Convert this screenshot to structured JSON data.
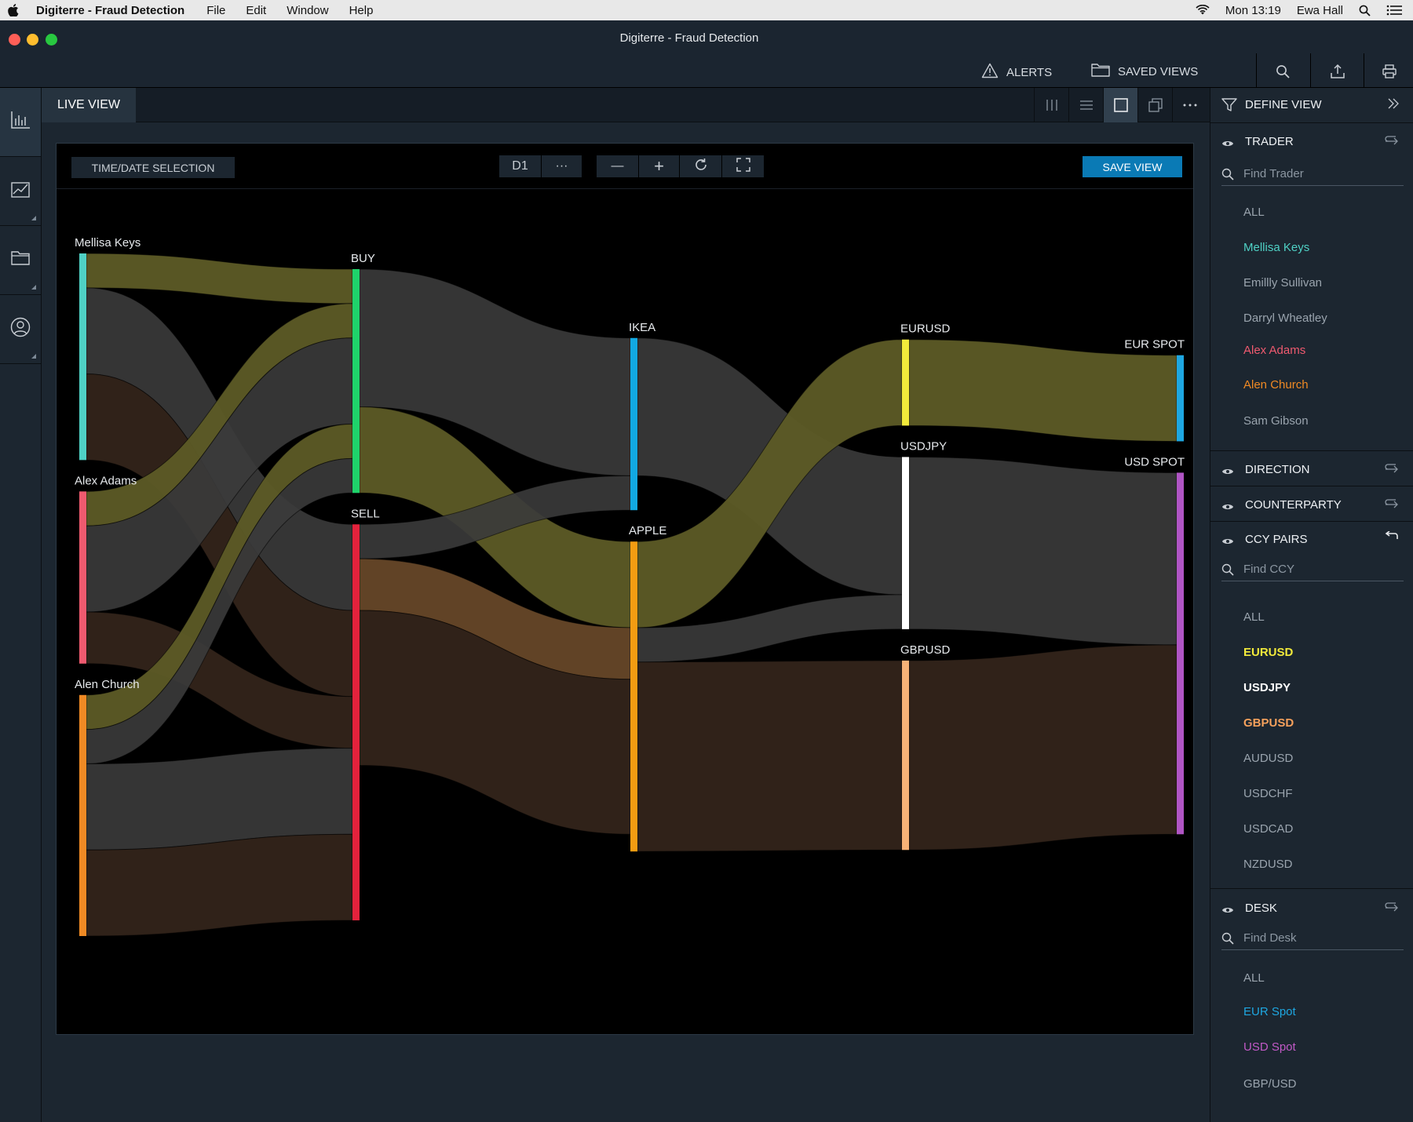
{
  "menubar": {
    "app_name": "Digiterre - Fraud Detection",
    "menus": [
      "File",
      "Edit",
      "Window",
      "Help"
    ],
    "clock": "Mon 13:19",
    "user": "Ewa Hall"
  },
  "window": {
    "title": "Digiterre - Fraud Detection",
    "alerts_label": "ALERTS",
    "saved_views_label": "SAVED VIEWS"
  },
  "tabbar": {
    "active_tab": "LIVE VIEW"
  },
  "toolbar": {
    "time_selection": "TIME/DATE SELECTION",
    "interval": "D1",
    "more": "···",
    "zoom_out": "—",
    "zoom_in": "+",
    "save_view": "SAVE VIEW"
  },
  "define_view": {
    "title": "DEFINE VIEW",
    "trader": {
      "label": "TRADER",
      "placeholder": "Find Trader",
      "items": [
        {
          "label": "ALL",
          "color": "#9aa4ae"
        },
        {
          "label": "Mellisa Keys",
          "color": "#4fd1c5"
        },
        {
          "label": "Emillly Sullivan",
          "color": "#9aa4ae"
        },
        {
          "label": "Darryl Wheatley",
          "color": "#9aa4ae"
        },
        {
          "label": "Alex Adams",
          "color": "#ef5a6f"
        },
        {
          "label": "Alen Church",
          "color": "#f08a24"
        },
        {
          "label": "Sam Gibson",
          "color": "#9aa4ae"
        }
      ]
    },
    "direction": {
      "label": "DIRECTION"
    },
    "counterparty": {
      "label": "COUNTERPARTY"
    },
    "ccy_pairs": {
      "label": "CCY PAIRS",
      "placeholder": "Find CCY",
      "items": [
        {
          "label": "ALL",
          "color": "#9aa4ae"
        },
        {
          "label": "EURUSD",
          "color": "#f2ea3b"
        },
        {
          "label": "USDJPY",
          "color": "#ffffff"
        },
        {
          "label": "GBPUSD",
          "color": "#f6a15c"
        },
        {
          "label": "AUDUSD",
          "color": "#9aa4ae"
        },
        {
          "label": "USDCHF",
          "color": "#9aa4ae"
        },
        {
          "label": "USDCAD",
          "color": "#9aa4ae"
        },
        {
          "label": "NZDUSD",
          "color": "#9aa4ae"
        }
      ]
    },
    "desk": {
      "label": "DESK",
      "placeholder": "Find Desk",
      "items": [
        {
          "label": "ALL",
          "color": "#9aa4ae"
        },
        {
          "label": "EUR Spot",
          "color": "#1ea7e1"
        },
        {
          "label": "USD Spot",
          "color": "#c25ac7"
        },
        {
          "label": "GBP/USD",
          "color": "#9aa4ae"
        }
      ]
    }
  },
  "chart_data": {
    "type": "sankey",
    "columns": [
      {
        "name": "Trader",
        "nodes": [
          "Mellisa Keys",
          "Alex Adams",
          "Alen Church"
        ]
      },
      {
        "name": "Direction",
        "nodes": [
          "BUY",
          "SELL"
        ]
      },
      {
        "name": "Counterparty",
        "nodes": [
          "IKEA",
          "APPLE"
        ]
      },
      {
        "name": "CCY Pair",
        "nodes": [
          "EURUSD",
          "USDJPY",
          "GBPUSD"
        ]
      },
      {
        "name": "Desk",
        "nodes": [
          "EUR SPOT",
          "USD SPOT"
        ]
      }
    ],
    "node_colors": {
      "Mellisa Keys": "#4fd1c5",
      "Alex Adams": "#ef5a6f",
      "Alen Church": "#f08a24",
      "BUY": "#1fd36b",
      "SELL": "#e3223c",
      "IKEA": "#12a9e3",
      "APPLE": "#f39c12",
      "EURUSD": "#f2ea3b",
      "USDJPY": "#ffffff",
      "GBPUSD": "#f6b277",
      "EUR SPOT": "#1ea7e1",
      "USD SPOT": "#b055c4"
    },
    "link_colors": {
      "highlight_yellow": "#5d5b26",
      "highlight_orange": "#6b4a2a",
      "grey": "#3b3b3b",
      "brown": "#33241a"
    },
    "links": [
      {
        "source": "Mellisa Keys",
        "target": "BUY",
        "value": 2,
        "style": "highlight_yellow"
      },
      {
        "source": "Mellisa Keys",
        "target": "SELL",
        "value": 5,
        "style": "grey"
      },
      {
        "source": "Mellisa Keys",
        "target": "SELL",
        "value": 5,
        "style": "brown"
      },
      {
        "source": "Alex Adams",
        "target": "BUY",
        "value": 2,
        "style": "highlight_yellow"
      },
      {
        "source": "Alex Adams",
        "target": "BUY",
        "value": 5,
        "style": "grey"
      },
      {
        "source": "Alex Adams",
        "target": "SELL",
        "value": 3,
        "style": "brown"
      },
      {
        "source": "Alen Church",
        "target": "BUY",
        "value": 2,
        "style": "highlight_yellow"
      },
      {
        "source": "Alen Church",
        "target": "BUY",
        "value": 2,
        "style": "grey"
      },
      {
        "source": "Alen Church",
        "target": "SELL",
        "value": 5,
        "style": "grey"
      },
      {
        "source": "Alen Church",
        "target": "SELL",
        "value": 5,
        "style": "brown"
      },
      {
        "source": "BUY",
        "target": "IKEA",
        "value": 8,
        "style": "grey"
      },
      {
        "source": "BUY",
        "target": "APPLE",
        "value": 5,
        "style": "highlight_yellow"
      },
      {
        "source": "SELL",
        "target": "IKEA",
        "value": 2,
        "style": "grey"
      },
      {
        "source": "SELL",
        "target": "APPLE",
        "value": 3,
        "style": "highlight_orange"
      },
      {
        "source": "SELL",
        "target": "APPLE",
        "value": 9,
        "style": "brown"
      },
      {
        "source": "IKEA",
        "target": "USDJPY",
        "value": 8,
        "style": "grey"
      },
      {
        "source": "APPLE",
        "target": "EURUSD",
        "value": 5,
        "style": "highlight_yellow"
      },
      {
        "source": "APPLE",
        "target": "USDJPY",
        "value": 2,
        "style": "grey"
      },
      {
        "source": "APPLE",
        "target": "GBPUSD",
        "value": 11,
        "style": "brown"
      },
      {
        "source": "EURUSD",
        "target": "EUR SPOT",
        "value": 5,
        "style": "highlight_yellow"
      },
      {
        "source": "USDJPY",
        "target": "USD SPOT",
        "value": 10,
        "style": "grey"
      },
      {
        "source": "GBPUSD",
        "target": "USD SPOT",
        "value": 11,
        "style": "brown"
      }
    ]
  }
}
